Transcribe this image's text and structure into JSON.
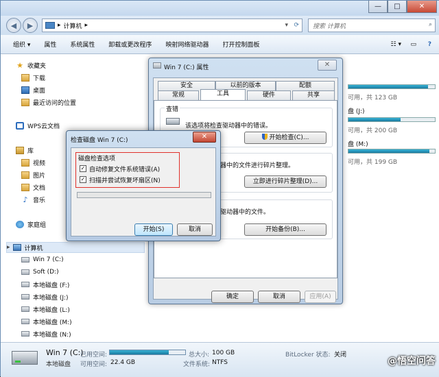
{
  "explorer": {
    "breadcrumb": "计算机",
    "search_placeholder": "搜索 计算机",
    "toolbar": [
      "组织 ▾",
      "属性",
      "系统属性",
      "卸载或更改程序",
      "映射网络驱动器",
      "打开控制面板"
    ],
    "sidebar": {
      "favorites": "收藏夹",
      "downloads": "下载",
      "desktop": "桌面",
      "recent": "最近访问的位置",
      "wps": "WPS云文档",
      "library": "库",
      "video": "视频",
      "pictures": "图片",
      "documents": "文档",
      "music": "音乐",
      "homegroup": "家庭组",
      "computer": "计算机",
      "drives": [
        "Win 7 (C:)",
        "Soft (D:)",
        "本地磁盘 (F:)",
        "本地磁盘 (J:)",
        "本地磁盘 (L:)",
        "本地磁盘 (M:)",
        "本地磁盘 (N:)"
      ]
    },
    "right": {
      "d1_free": "可用，共 123 GB",
      "d2_label": "盘 (J:)",
      "d2_free": "可用，共 200 GB",
      "d3_label": "盘 (M:)",
      "d3_free": "可用，共 199 GB",
      "fill1": 0.92,
      "fill2": 0.6,
      "fill3": 0.94
    },
    "details": {
      "name": "Win 7 (C:)",
      "used_label": "已用空间:",
      "free_label": "可用空间:",
      "free_value": "22.4 GB",
      "type": "本地磁盘",
      "total_label": "总大小:",
      "total_value": "100 GB",
      "fs_label": "文件系统:",
      "fs_value": "NTFS",
      "bitlocker_label": "BitLocker 状态:",
      "bitlocker_value": "关闭",
      "used_fraction": 0.78,
      "watermark": "@悟空问答"
    }
  },
  "props": {
    "title": "Win 7 (C:) 属性",
    "tabs_row1": [
      "安全",
      "以前的版本",
      "配额"
    ],
    "tabs_row2": [
      "常规",
      "工具",
      "硬件",
      "共享"
    ],
    "check_group": "查错",
    "check_text": "该选项将检查驱动器中的错误。",
    "check_button": "开始检查(C)...",
    "defrag_text": "动器中的文件进行碎片整理。",
    "defrag_button": "立即进行碎片整理(D)...",
    "backup_text": "份驱动器中的文件。",
    "backup_button": "开始备份(B)...",
    "ok": "确定",
    "cancel": "取消",
    "apply": "应用(A)"
  },
  "checkdisk": {
    "title": "检查磁盘 Win 7 (C:)",
    "group": "磁盘检查选项",
    "opt1": "自动修复文件系统错误(A)",
    "opt2": "扫描并尝试恢复坏扇区(N)",
    "start": "开始(S)",
    "cancel": "取消"
  }
}
